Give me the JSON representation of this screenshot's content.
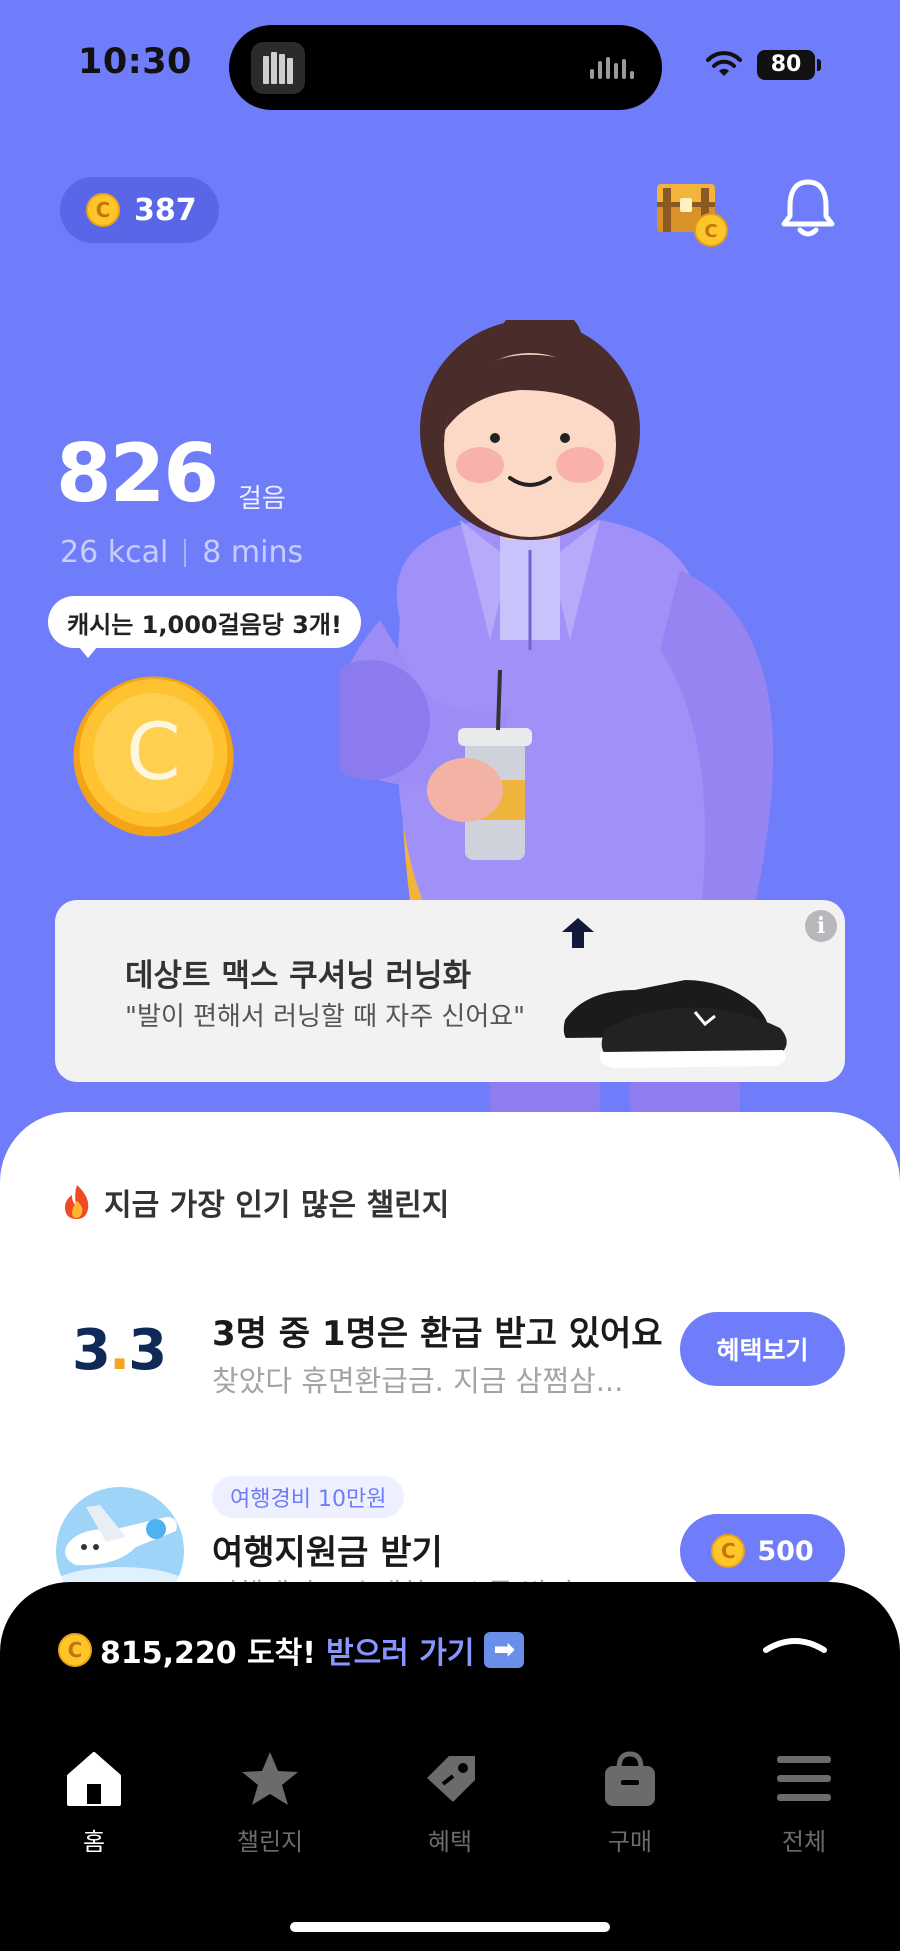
{
  "status_bar": {
    "time": "10:30",
    "battery": "80"
  },
  "header": {
    "coin_balance": "387",
    "coin_symbol": "C"
  },
  "steps": {
    "count": "826",
    "unit": "걸음",
    "kcal": "26 kcal",
    "mins": "8 mins"
  },
  "reward_bubble": "캐시는 1,000걸음당 3개!",
  "ad": {
    "title": "데상트 맥스 쿠셔닝 러닝화",
    "subtitle": "\"발이 편해서 러닝할 때 자주 신어요\"",
    "info": "i"
  },
  "challenges": {
    "section_title": "지금 가장 인기 많은 챌린지",
    "items": [
      {
        "logo_text": "3.3",
        "title": "3명 중 1명은 환급 받고 있어요",
        "subtitle": "찾았다 휴면환급금. 지금 삼쩜삼...",
        "button": "혜택보기"
      },
      {
        "badge": "여행경비 10만원",
        "title": "여행지원금 받기",
        "subtitle": "여행매이트 초대하고 소득 받기",
        "button": "500"
      }
    ]
  },
  "bottom_sheet": {
    "amount": "815,220 도착!",
    "link": "받으러 가기",
    "arrow": "➡"
  },
  "tabs": [
    {
      "label": "홈",
      "icon": "home-icon"
    },
    {
      "label": "챌린지",
      "icon": "star-icon"
    },
    {
      "label": "혜택",
      "icon": "tag-icon"
    },
    {
      "label": "구매",
      "icon": "bag-icon"
    },
    {
      "label": "전체",
      "icon": "menu-icon"
    }
  ],
  "colors": {
    "background": "#6f7dfa",
    "accent": "#6f7dfa",
    "coin": "#ffc629"
  }
}
